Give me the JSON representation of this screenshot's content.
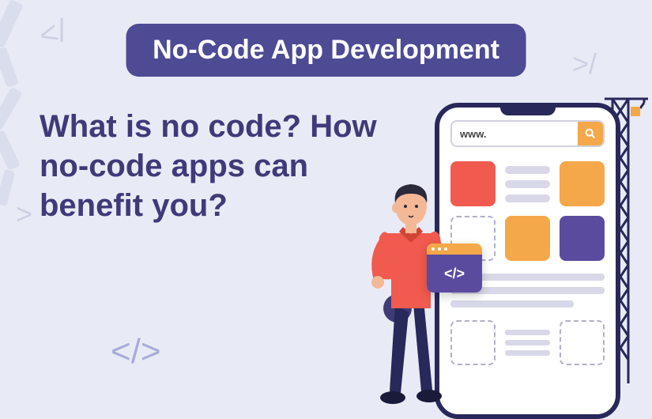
{
  "title": "No-Code App Development",
  "subheading": "What is no code? How no-code apps can benefit you?",
  "search": {
    "placeholder": "www."
  },
  "code_card": {
    "symbol": "</>"
  },
  "colors": {
    "primary_purple": "#4d4b94",
    "dark_text": "#3f3a78",
    "accent_red": "#f15a4e",
    "accent_orange": "#f5a849",
    "accent_purple": "#5b4b9e",
    "background": "#e8ebf5"
  },
  "decorative_glyphs": {
    "bracket1": "</",
    "bracket2": ">/",
    "bracket3": "</>",
    "slash1": "//",
    "slash2": ">"
  }
}
